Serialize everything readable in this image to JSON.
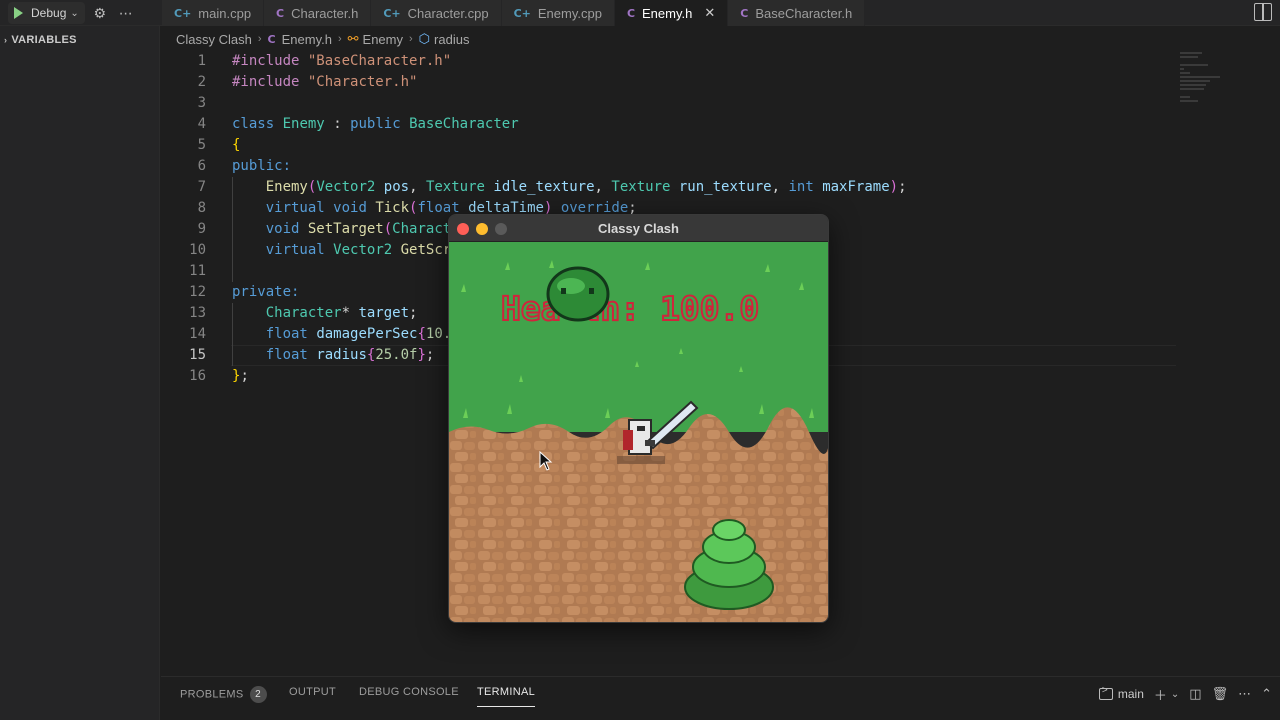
{
  "debug": {
    "config_label": "Debug",
    "settings_icon": "gear-icon",
    "more_icon": "ellipsis-icon"
  },
  "tabs": [
    {
      "label": "main.cpp",
      "type": "C++",
      "icon": "cpp-file-icon"
    },
    {
      "label": "Character.h",
      "type": "C",
      "icon": "header-file-icon"
    },
    {
      "label": "Character.cpp",
      "type": "C++",
      "icon": "cpp-file-icon"
    },
    {
      "label": "Enemy.cpp",
      "type": "C++",
      "icon": "cpp-file-icon"
    },
    {
      "label": "Enemy.h",
      "type": "C",
      "icon": "header-file-icon",
      "active": true
    },
    {
      "label": "BaseCharacter.h",
      "type": "C",
      "icon": "header-file-icon"
    }
  ],
  "sidebar": {
    "section": "VARIABLES"
  },
  "breadcrumb": {
    "project": "Classy Clash",
    "file": "Enemy.h",
    "file_icon_letter": "C",
    "class": "Enemy",
    "member": "radius"
  },
  "code": {
    "current_line": 15,
    "line_numbers": [
      "1",
      "2",
      "3",
      "4",
      "5",
      "6",
      "7",
      "8",
      "9",
      "10",
      "11",
      "12",
      "13",
      "14",
      "15",
      "16"
    ]
  },
  "panel": {
    "tabs": [
      "PROBLEMS",
      "OUTPUT",
      "DEBUG CONSOLE",
      "TERMINAL"
    ],
    "active_tab": "TERMINAL",
    "problems_count": "2",
    "terminal_name": "main"
  },
  "game": {
    "window_title": "Classy Clash",
    "hud_text": "Health: 100.0",
    "colors": {
      "grass": "#41a34b",
      "dirt": "#b07a52",
      "hud": "#d0243c",
      "slime": "#3aa23f",
      "bush": "#4fb84f"
    }
  },
  "colors": {
    "accent": "#007acc",
    "editor_bg": "#1e1e1e",
    "sidebar_bg": "#252526"
  }
}
